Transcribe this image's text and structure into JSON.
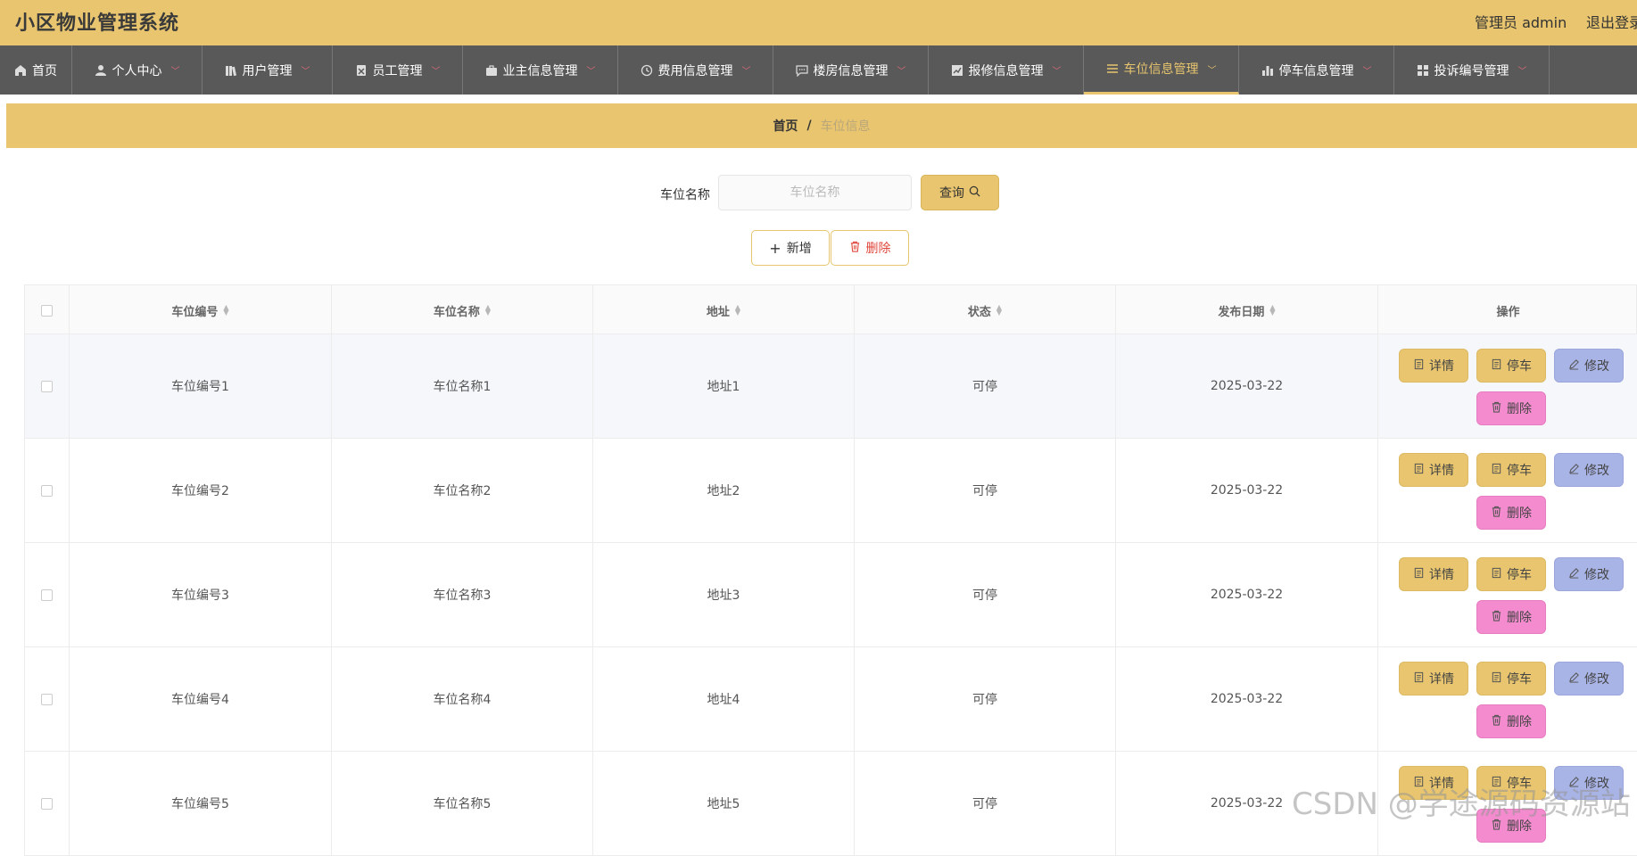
{
  "header": {
    "app_title": "小区物业管理系统",
    "admin_label": "管理员 admin",
    "logout_label": "退出登录"
  },
  "nav": {
    "items": [
      {
        "label": "首页",
        "icon": "home-icon",
        "has_dropdown": false,
        "active": false
      },
      {
        "label": "个人中心",
        "icon": "user-icon",
        "has_dropdown": true,
        "active": false
      },
      {
        "label": "用户管理",
        "icon": "books-icon",
        "has_dropdown": true,
        "active": false
      },
      {
        "label": "员工管理",
        "icon": "badge-icon",
        "has_dropdown": true,
        "active": false
      },
      {
        "label": "业主信息管理",
        "icon": "briefcase-icon",
        "has_dropdown": true,
        "active": false
      },
      {
        "label": "费用信息管理",
        "icon": "clock-icon",
        "has_dropdown": true,
        "active": false
      },
      {
        "label": "楼房信息管理",
        "icon": "chat-icon",
        "has_dropdown": true,
        "active": false
      },
      {
        "label": "报修信息管理",
        "icon": "chart-line-icon",
        "has_dropdown": true,
        "active": false
      },
      {
        "label": "车位信息管理",
        "icon": "list-icon",
        "has_dropdown": true,
        "active": true
      },
      {
        "label": "停车信息管理",
        "icon": "bar-chart-icon",
        "has_dropdown": true,
        "active": false
      },
      {
        "label": "投诉编号管理",
        "icon": "grid-icon",
        "has_dropdown": true,
        "active": false
      }
    ]
  },
  "breadcrumb": {
    "home": "首页",
    "separator": "/",
    "current": "车位信息"
  },
  "search": {
    "label": "车位名称",
    "placeholder": "车位名称",
    "value": "",
    "query_label": "查询"
  },
  "actions": {
    "add_label": "新增",
    "delete_label": "删除"
  },
  "table": {
    "columns": [
      "车位编号",
      "车位名称",
      "地址",
      "状态",
      "发布日期",
      "操作"
    ],
    "rows": [
      {
        "code": "车位编号1",
        "name": "车位名称1",
        "address": "地址1",
        "status": "可停",
        "date": "2025-03-22"
      },
      {
        "code": "车位编号2",
        "name": "车位名称2",
        "address": "地址2",
        "status": "可停",
        "date": "2025-03-22"
      },
      {
        "code": "车位编号3",
        "name": "车位名称3",
        "address": "地址3",
        "status": "可停",
        "date": "2025-03-22"
      },
      {
        "code": "车位编号4",
        "name": "车位名称4",
        "address": "地址4",
        "status": "可停",
        "date": "2025-03-22"
      },
      {
        "code": "车位编号5",
        "name": "车位名称5",
        "address": "地址5",
        "status": "可停",
        "date": "2025-03-22"
      }
    ],
    "row_actions": {
      "detail": "详情",
      "park": "停车",
      "edit": "修改",
      "delete": "删除"
    }
  },
  "watermark": "CSDN @学途源码资源站",
  "colors": {
    "accent": "#e8c56e",
    "nav_bg": "#595959",
    "edit_button": "#a9b4e6",
    "delete_button": "#f58bcf",
    "danger_text": "#e0463b"
  }
}
